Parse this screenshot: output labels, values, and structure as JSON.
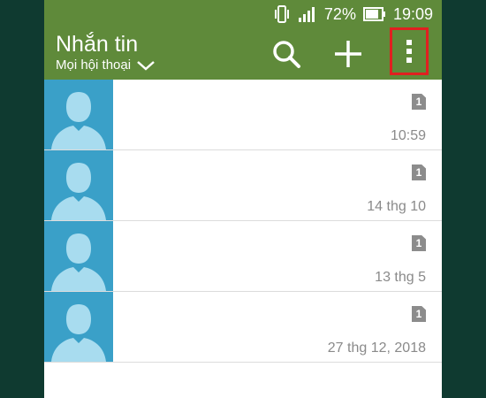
{
  "status": {
    "battery": "72%",
    "time": "19:09"
  },
  "header": {
    "title": "Nhắn tin",
    "subtitle": "Mọi hội thoại"
  },
  "conversations": [
    {
      "sim": "1",
      "time": "10:59"
    },
    {
      "sim": "1",
      "time": "14 thg 10"
    },
    {
      "sim": "1",
      "time": "13 thg 5"
    },
    {
      "sim": "1",
      "time": "27 thg 12, 2018"
    }
  ],
  "colors": {
    "appbar": "#5f8a3a",
    "avatar": "#3aa0c8",
    "highlight": "#e02020"
  }
}
